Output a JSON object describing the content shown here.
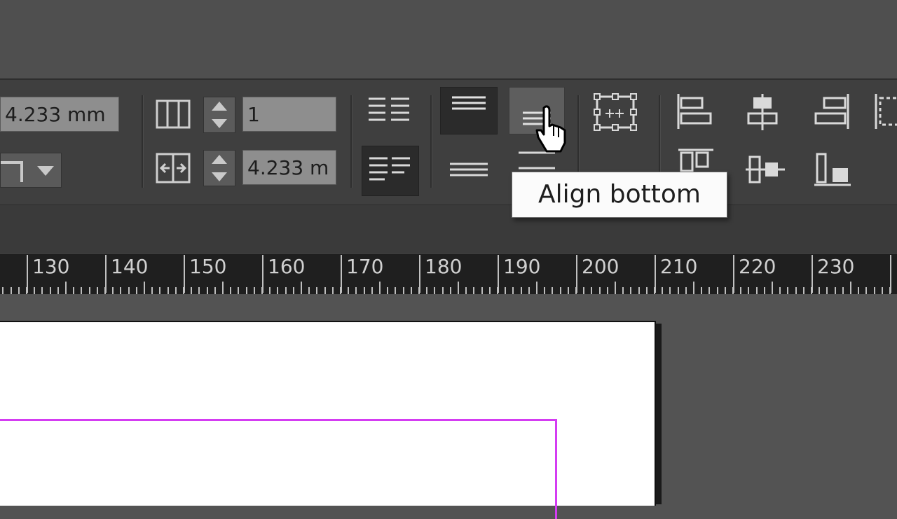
{
  "control_panel": {
    "gutter_top_value": "4.233 mm",
    "columns_value": "1",
    "gutter_value": "4.233 m"
  },
  "tooltip": {
    "text": "Align bottom"
  },
  "ruler": {
    "labels": [
      "130",
      "140",
      "150",
      "160",
      "170",
      "180",
      "190",
      "200",
      "210",
      "220",
      "230"
    ]
  },
  "colors": {
    "panel": "#3f3f3f",
    "field": "#8e8e8e",
    "margin_guide": "#d43cf2",
    "ruler": "#1f1f1f"
  },
  "icons": {
    "align_left": "align-left-icon",
    "align_center_h": "align-horizontal-center-icon",
    "align_right": "align-right-icon",
    "align_top": "align-top-icon",
    "align_center_v": "align-vertical-center-icon",
    "align_bottom": "align-bottom-icon",
    "cursor": "hand-cursor-icon"
  }
}
